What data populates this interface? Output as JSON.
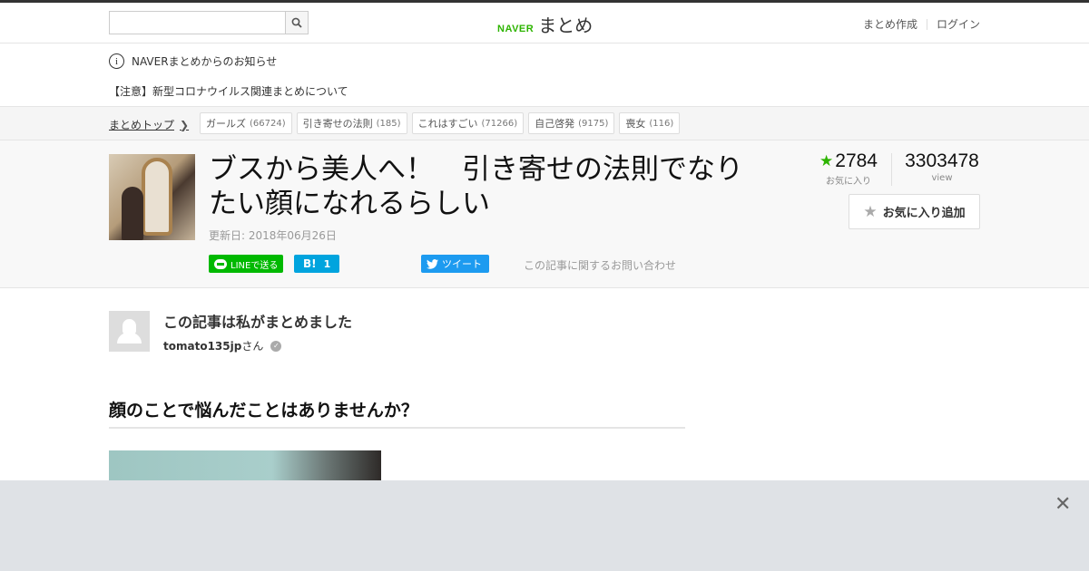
{
  "header": {
    "search_placeholder": "",
    "logo_brand": "NAVER",
    "logo_name": "まとめ",
    "create_link": "まとめ作成",
    "login_link": "ログイン"
  },
  "notice": {
    "heading": "NAVERまとめからのお知らせ",
    "link_text": "【注意】新型コロナウイルス関連まとめについて"
  },
  "tagbar": {
    "crumb": "まとめトップ",
    "tags": [
      {
        "label": "ガールズ",
        "count": "(66724)"
      },
      {
        "label": "引き寄せの法則",
        "count": "(185)"
      },
      {
        "label": "これはすごい",
        "count": "(71266)"
      },
      {
        "label": "自己啓発",
        "count": "(9175)"
      },
      {
        "label": "喪女",
        "count": "(116)"
      }
    ]
  },
  "article": {
    "title": "ブスから美人へ！　引き寄せの法則でなりたい顔になれるらしい",
    "updated": "更新日: 2018年06月26日",
    "share_line": "LINEで送る",
    "share_hatena": "B!",
    "share_hatena_count": "1",
    "share_tweet": "ツイート",
    "contact": "この記事に関するお問い合わせ",
    "favorites": "2784",
    "favorites_label": "お気に入り",
    "views": "3303478",
    "views_label": "view",
    "fav_button": "お気に入り追加"
  },
  "author": {
    "heading": "この記事は私がまとめました",
    "name": "tomato135jp",
    "suffix": "さん"
  },
  "content": {
    "section_heading": "顔のことで悩んだことはありませんか？"
  },
  "colors": {
    "naver_green": "#2db400",
    "tweet_blue": "#1d9bf0",
    "hatena_blue": "#00a4de",
    "line_green": "#00b900"
  }
}
